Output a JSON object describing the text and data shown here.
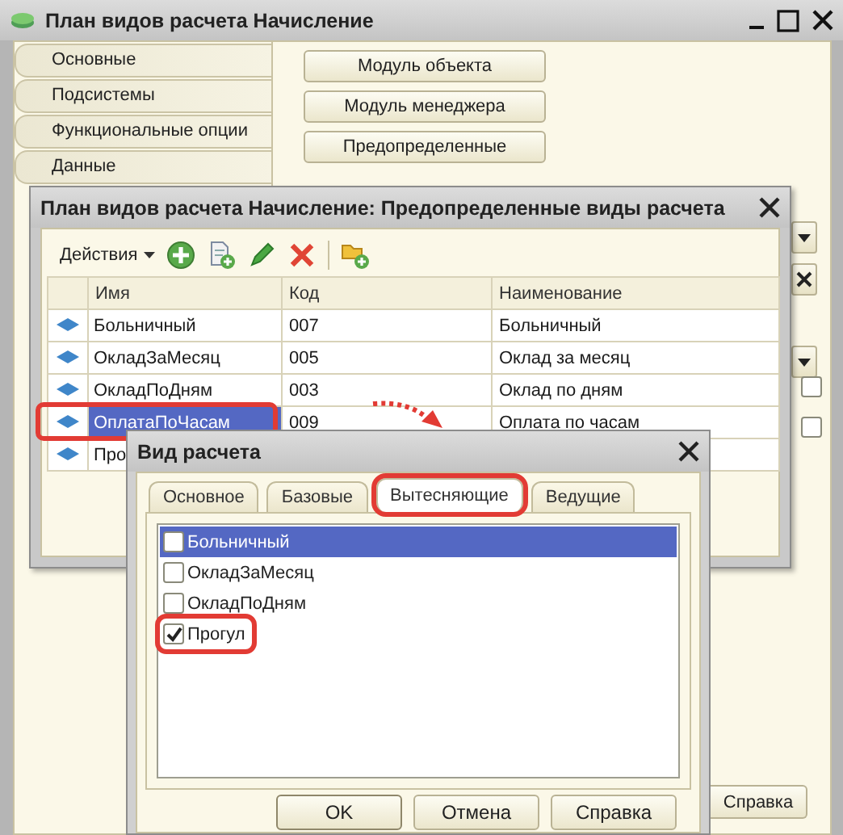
{
  "main_window": {
    "title": "План видов расчета Начисление",
    "tabs": [
      {
        "label": "Основные"
      },
      {
        "label": "Подсистемы"
      },
      {
        "label": "Функциональные опции"
      },
      {
        "label": "Данные"
      }
    ],
    "buttons": [
      "Модуль объекта",
      "Модуль менеджера",
      "Предопределенные"
    ],
    "side_checkboxes": [
      {
        "checked": false
      },
      {
        "checked": false
      }
    ],
    "help_button": "Справка"
  },
  "predefined_window": {
    "title": "План видов расчета Начисление: Предопределенные виды расчета",
    "actions_menu": "Действия",
    "columns": [
      "Имя",
      "Код",
      "Наименование"
    ],
    "rows": [
      {
        "name": "Больничный",
        "code": "007",
        "description": "Больничный",
        "selected": false
      },
      {
        "name": "ОкладЗаМесяц",
        "code": "005",
        "description": "Оклад за месяц",
        "selected": false
      },
      {
        "name": "ОкладПоДням",
        "code": "003",
        "description": "Оклад по дням",
        "selected": false
      },
      {
        "name": "ОплатаПоЧасам",
        "code": "009",
        "description": "Оплата по часам",
        "selected": true
      },
      {
        "name": "Про",
        "selected": false
      }
    ]
  },
  "calc_dialog": {
    "title": "Вид расчета",
    "tabs": [
      {
        "label": "Основное",
        "selected": false
      },
      {
        "label": "Базовые",
        "selected": false
      },
      {
        "label": "Вытесняющие",
        "selected": true
      },
      {
        "label": "Ведущие",
        "selected": false
      }
    ],
    "items": [
      {
        "label": "Больничный",
        "checked": false,
        "selected": true
      },
      {
        "label": "ОкладЗаМесяц",
        "checked": false,
        "selected": false
      },
      {
        "label": "ОкладПоДням",
        "checked": false,
        "selected": false
      },
      {
        "label": "Прогул",
        "checked": true,
        "selected": false
      }
    ],
    "buttons": [
      "OK",
      "Отмена",
      "Справка"
    ]
  }
}
